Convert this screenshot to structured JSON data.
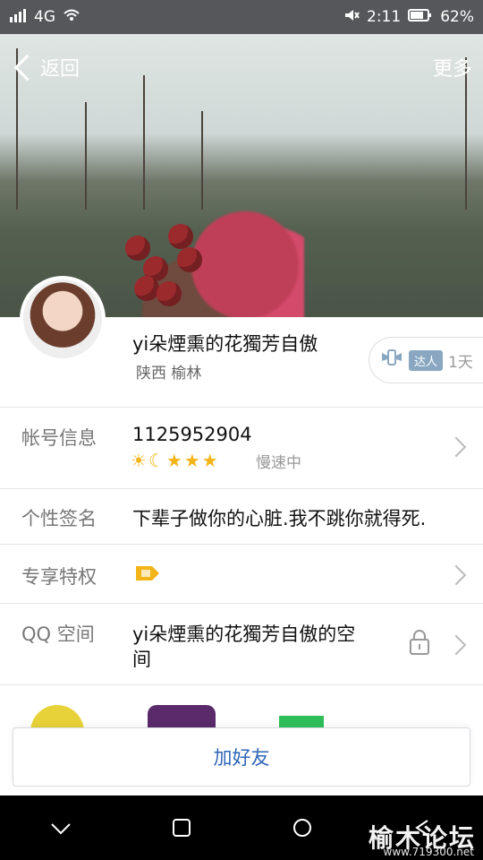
{
  "statusbar": {
    "network": "4G",
    "time": "2:11",
    "battery": "62%"
  },
  "nav": {
    "back_label": "返回",
    "more_label": "更多"
  },
  "profile": {
    "nickname": "yi朵煙熏的花獨芳自傲",
    "location": "陕西 榆林",
    "daren_tag": "达人",
    "daren_days": "1天"
  },
  "rows": [
    {
      "label": "帐号信息",
      "value": "1125952904",
      "sub": "慢速中"
    },
    {
      "label": "个性签名",
      "value": "下辈子做你的心脏.我不跳你就得死."
    },
    {
      "label": "专享特权"
    },
    {
      "label": "QQ 空间",
      "value_line1": "yi朵煙熏的花獨芳自傲的空",
      "value_line2": "间"
    }
  ],
  "add_friend_label": "加好友",
  "watermark": {
    "title": "榆木论坛",
    "url": "www.719300.net"
  }
}
